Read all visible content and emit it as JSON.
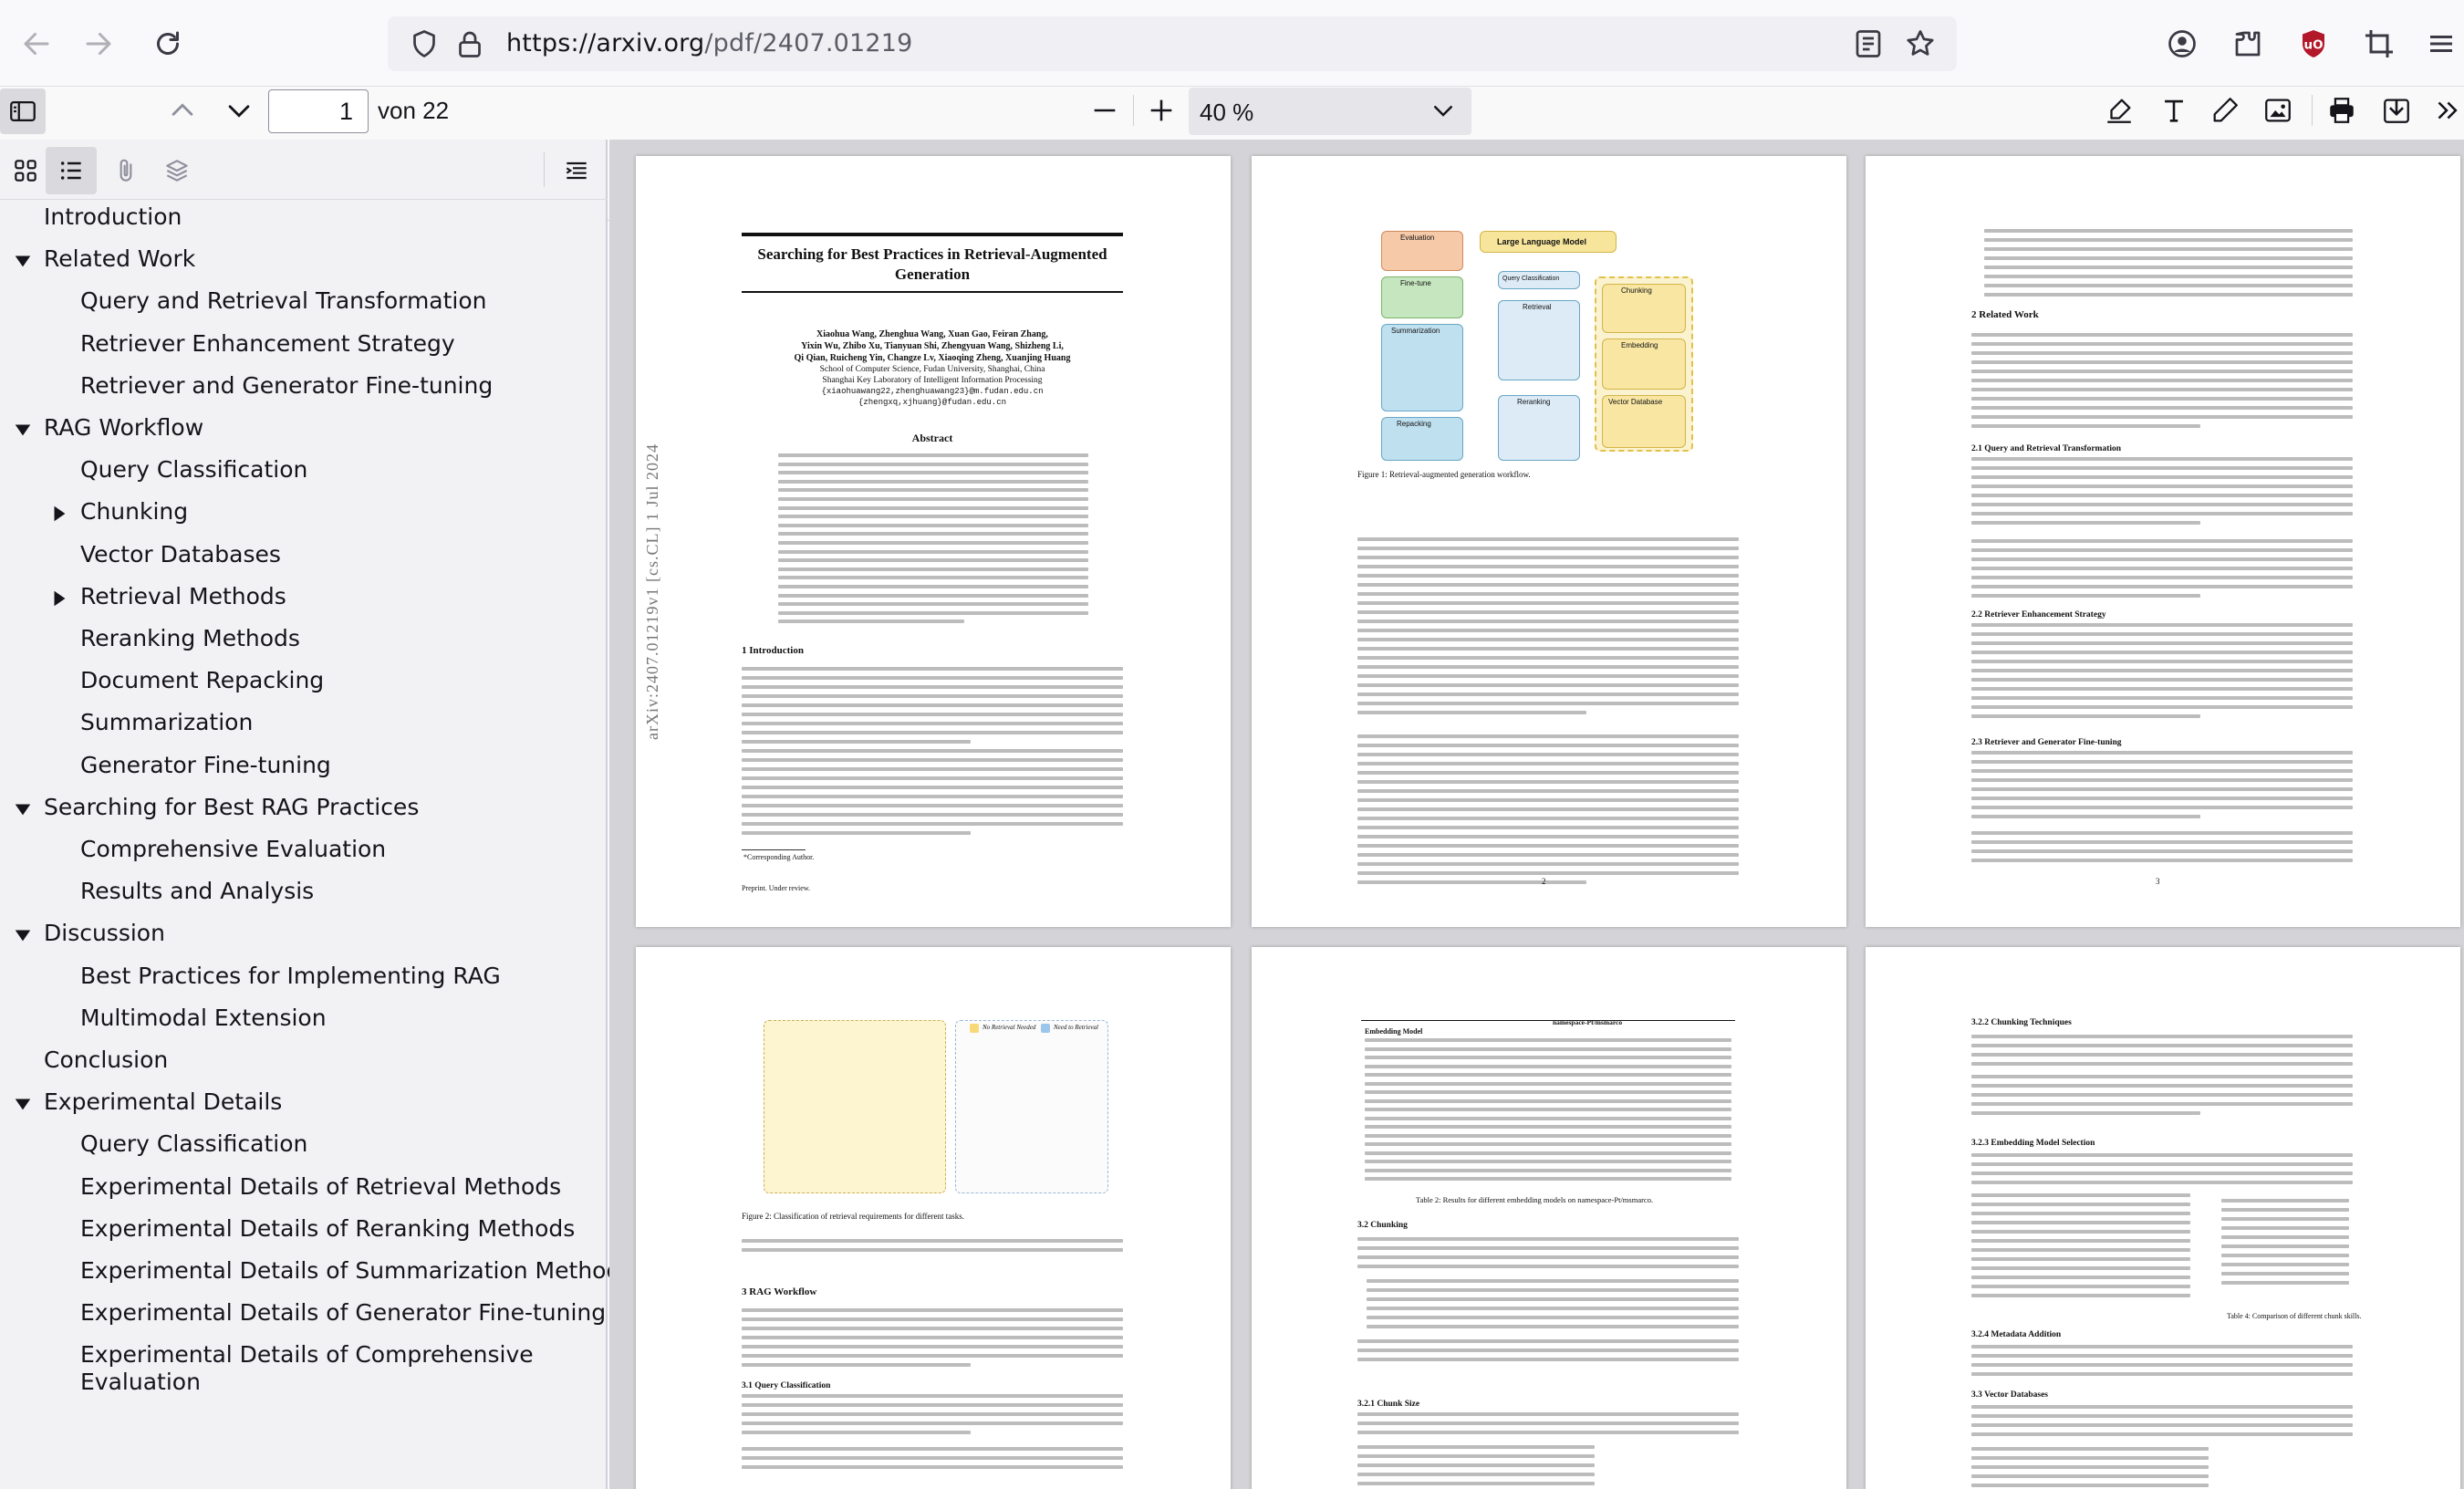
{
  "browser": {
    "url": "https://arxiv.org/pdf/2407.01219",
    "url_host": "https://arxiv.org",
    "url_path": "/pdf/2407.01219"
  },
  "pdf_toolbar": {
    "page_number": "1",
    "page_count": "von 22",
    "zoom": "40 %"
  },
  "outline": [
    {
      "label": "Introduction",
      "level": 0,
      "toggle": "none"
    },
    {
      "label": "Related Work",
      "level": 0,
      "toggle": "expanded"
    },
    {
      "label": "Query and Retrieval Transformation",
      "level": 1,
      "toggle": "none"
    },
    {
      "label": "Retriever Enhancement Strategy",
      "level": 1,
      "toggle": "none"
    },
    {
      "label": "Retriever and Generator Fine-tuning",
      "level": 1,
      "toggle": "none"
    },
    {
      "label": "RAG Workflow",
      "level": 0,
      "toggle": "expanded"
    },
    {
      "label": "Query Classification",
      "level": 1,
      "toggle": "none"
    },
    {
      "label": "Chunking",
      "level": 1,
      "toggle": "collapsed"
    },
    {
      "label": "Vector Databases",
      "level": 1,
      "toggle": "none"
    },
    {
      "label": "Retrieval Methods",
      "level": 1,
      "toggle": "collapsed"
    },
    {
      "label": "Reranking Methods",
      "level": 1,
      "toggle": "none"
    },
    {
      "label": "Document Repacking",
      "level": 1,
      "toggle": "none"
    },
    {
      "label": "Summarization",
      "level": 1,
      "toggle": "none"
    },
    {
      "label": "Generator Fine-tuning",
      "level": 1,
      "toggle": "none"
    },
    {
      "label": "Searching for Best RAG Practices",
      "level": 0,
      "toggle": "expanded"
    },
    {
      "label": "Comprehensive Evaluation",
      "level": 1,
      "toggle": "none"
    },
    {
      "label": "Results and Analysis",
      "level": 1,
      "toggle": "none"
    },
    {
      "label": "Discussion",
      "level": 0,
      "toggle": "expanded"
    },
    {
      "label": "Best Practices for Implementing RAG",
      "level": 1,
      "toggle": "none"
    },
    {
      "label": "Multimodal Extension",
      "level": 1,
      "toggle": "none"
    },
    {
      "label": "Conclusion",
      "level": 0,
      "toggle": "none"
    },
    {
      "label": "Experimental Details",
      "level": 0,
      "toggle": "expanded"
    },
    {
      "label": "Query Classification",
      "level": 1,
      "toggle": "none"
    },
    {
      "label": "Experimental Details of Retrieval Methods",
      "level": 1,
      "toggle": "none"
    },
    {
      "label": "Experimental Details of Reranking Methods",
      "level": 1,
      "toggle": "none"
    },
    {
      "label": "Experimental Details of Summarization Methods",
      "level": 1,
      "toggle": "none"
    },
    {
      "label": "Experimental Details of Generator Fine-tuning",
      "level": 1,
      "toggle": "none"
    },
    {
      "label": "Experimental Details of Comprehensive",
      "level": 1,
      "toggle": "none",
      "label_line2": "Evaluation"
    }
  ],
  "pages": {
    "p1": {
      "title_line1": "Searching for Best Practices in Retrieval-Augmented",
      "title_line2": "Generation",
      "authors_line1": "Xiaohua Wang, Zhenghua Wang, Xuan Gao, Feiran Zhang,",
      "authors_line2": "Yixin Wu, Zhibo Xu, Tianyuan Shi, Zhengyuan Wang, Shizheng Li,",
      "authors_line3": "Qi Qian, Ruicheng Yin, Changze Lv, Xiaoqing Zheng, Xuanjing Huang",
      "affil_line1": "School of Computer Science, Fudan University, Shanghai, China",
      "affil_line2": "Shanghai Key Laboratory of Intelligent Information Processing",
      "email_line1": "{xiaohuawang22,zhenghuawang23}@m.fudan.edu.cn",
      "email_line2": "{zhengxq,xjhuang}@fudan.edu.cn",
      "abstract_heading": "Abstract",
      "intro_heading": "1   Introduction",
      "side_stamp": "arXiv:2407.01219v1  [cs.CL]  1 Jul 2024",
      "footnote": "*Corresponding Author.",
      "preprint": "Preprint. Under review."
    },
    "p2": {
      "figure_caption": "Figure 1:  Retrieval-augmented generation workflow.",
      "llm_label": "Large Language Model",
      "box_labels": [
        "Evaluation",
        "Fine-tune",
        "Summarization",
        "Repacking",
        "Query Classification",
        "Retrieval",
        "Reranking",
        "Chunking",
        "Embedding",
        "Vector Database"
      ],
      "page_number": "2"
    },
    "p3": {
      "heading_related": "2   Related Work",
      "heading_21": "2.1   Query and Retrieval Transformation",
      "heading_22": "2.2   Retriever Enhancement Strategy",
      "heading_23": "2.3   Retriever and Generator Fine-tuning",
      "page_number": "3"
    },
    "p4": {
      "figure_caption": "Figure 2:  Classification of retrieval requirements for different tasks.",
      "legend_no": "No Retrieval Needed",
      "legend_need": "Need to Retrieval",
      "heading_rag": "3   RAG Workflow",
      "heading_31": "3.1   Query Classification"
    },
    "p5": {
      "table_header_model": "Embedding Model",
      "table_header_dataset": "namespace-Pt/msmarco",
      "table_caption": "Table 2:  Results for different embedding models on namespace-Pt/msmarco.",
      "heading_32": "3.2   Chunking",
      "heading_321": "3.2.1   Chunk Size"
    },
    "p6": {
      "heading_322": "3.2.2   Chunking Techniques",
      "heading_323": "3.2.3   Embedding Model Selection",
      "heading_324": "3.2.4   Metadata Addition",
      "heading_33": "3.3   Vector Databases",
      "table_caption": "Table 4: Comparison of different chunk skills."
    }
  },
  "colors": {
    "toolbar_bg": "#f9f9fa",
    "sidebar_bg": "#f2f2f4",
    "viewer_bg": "#d4d4d8",
    "ublock_red": "#b3172a",
    "link_blue": "#1e40cc"
  },
  "icons": [
    "back-arrow-icon",
    "forward-arrow-icon",
    "reload-icon",
    "shield-icon",
    "lock-icon",
    "reader-view-icon",
    "bookmark-star-icon",
    "account-icon",
    "extensions-icon",
    "ublock-icon",
    "crop-icon",
    "menu-icon",
    "sidebar-toggle-icon",
    "chevron-up-icon",
    "chevron-down-icon",
    "zoom-out-icon",
    "zoom-in-icon",
    "highlight-icon",
    "text-icon",
    "draw-icon",
    "image-icon",
    "print-icon",
    "save-icon",
    "more-tools-icon",
    "thumbnails-icon",
    "outline-icon",
    "attachments-icon",
    "layers-icon",
    "current-outline-item-icon"
  ]
}
